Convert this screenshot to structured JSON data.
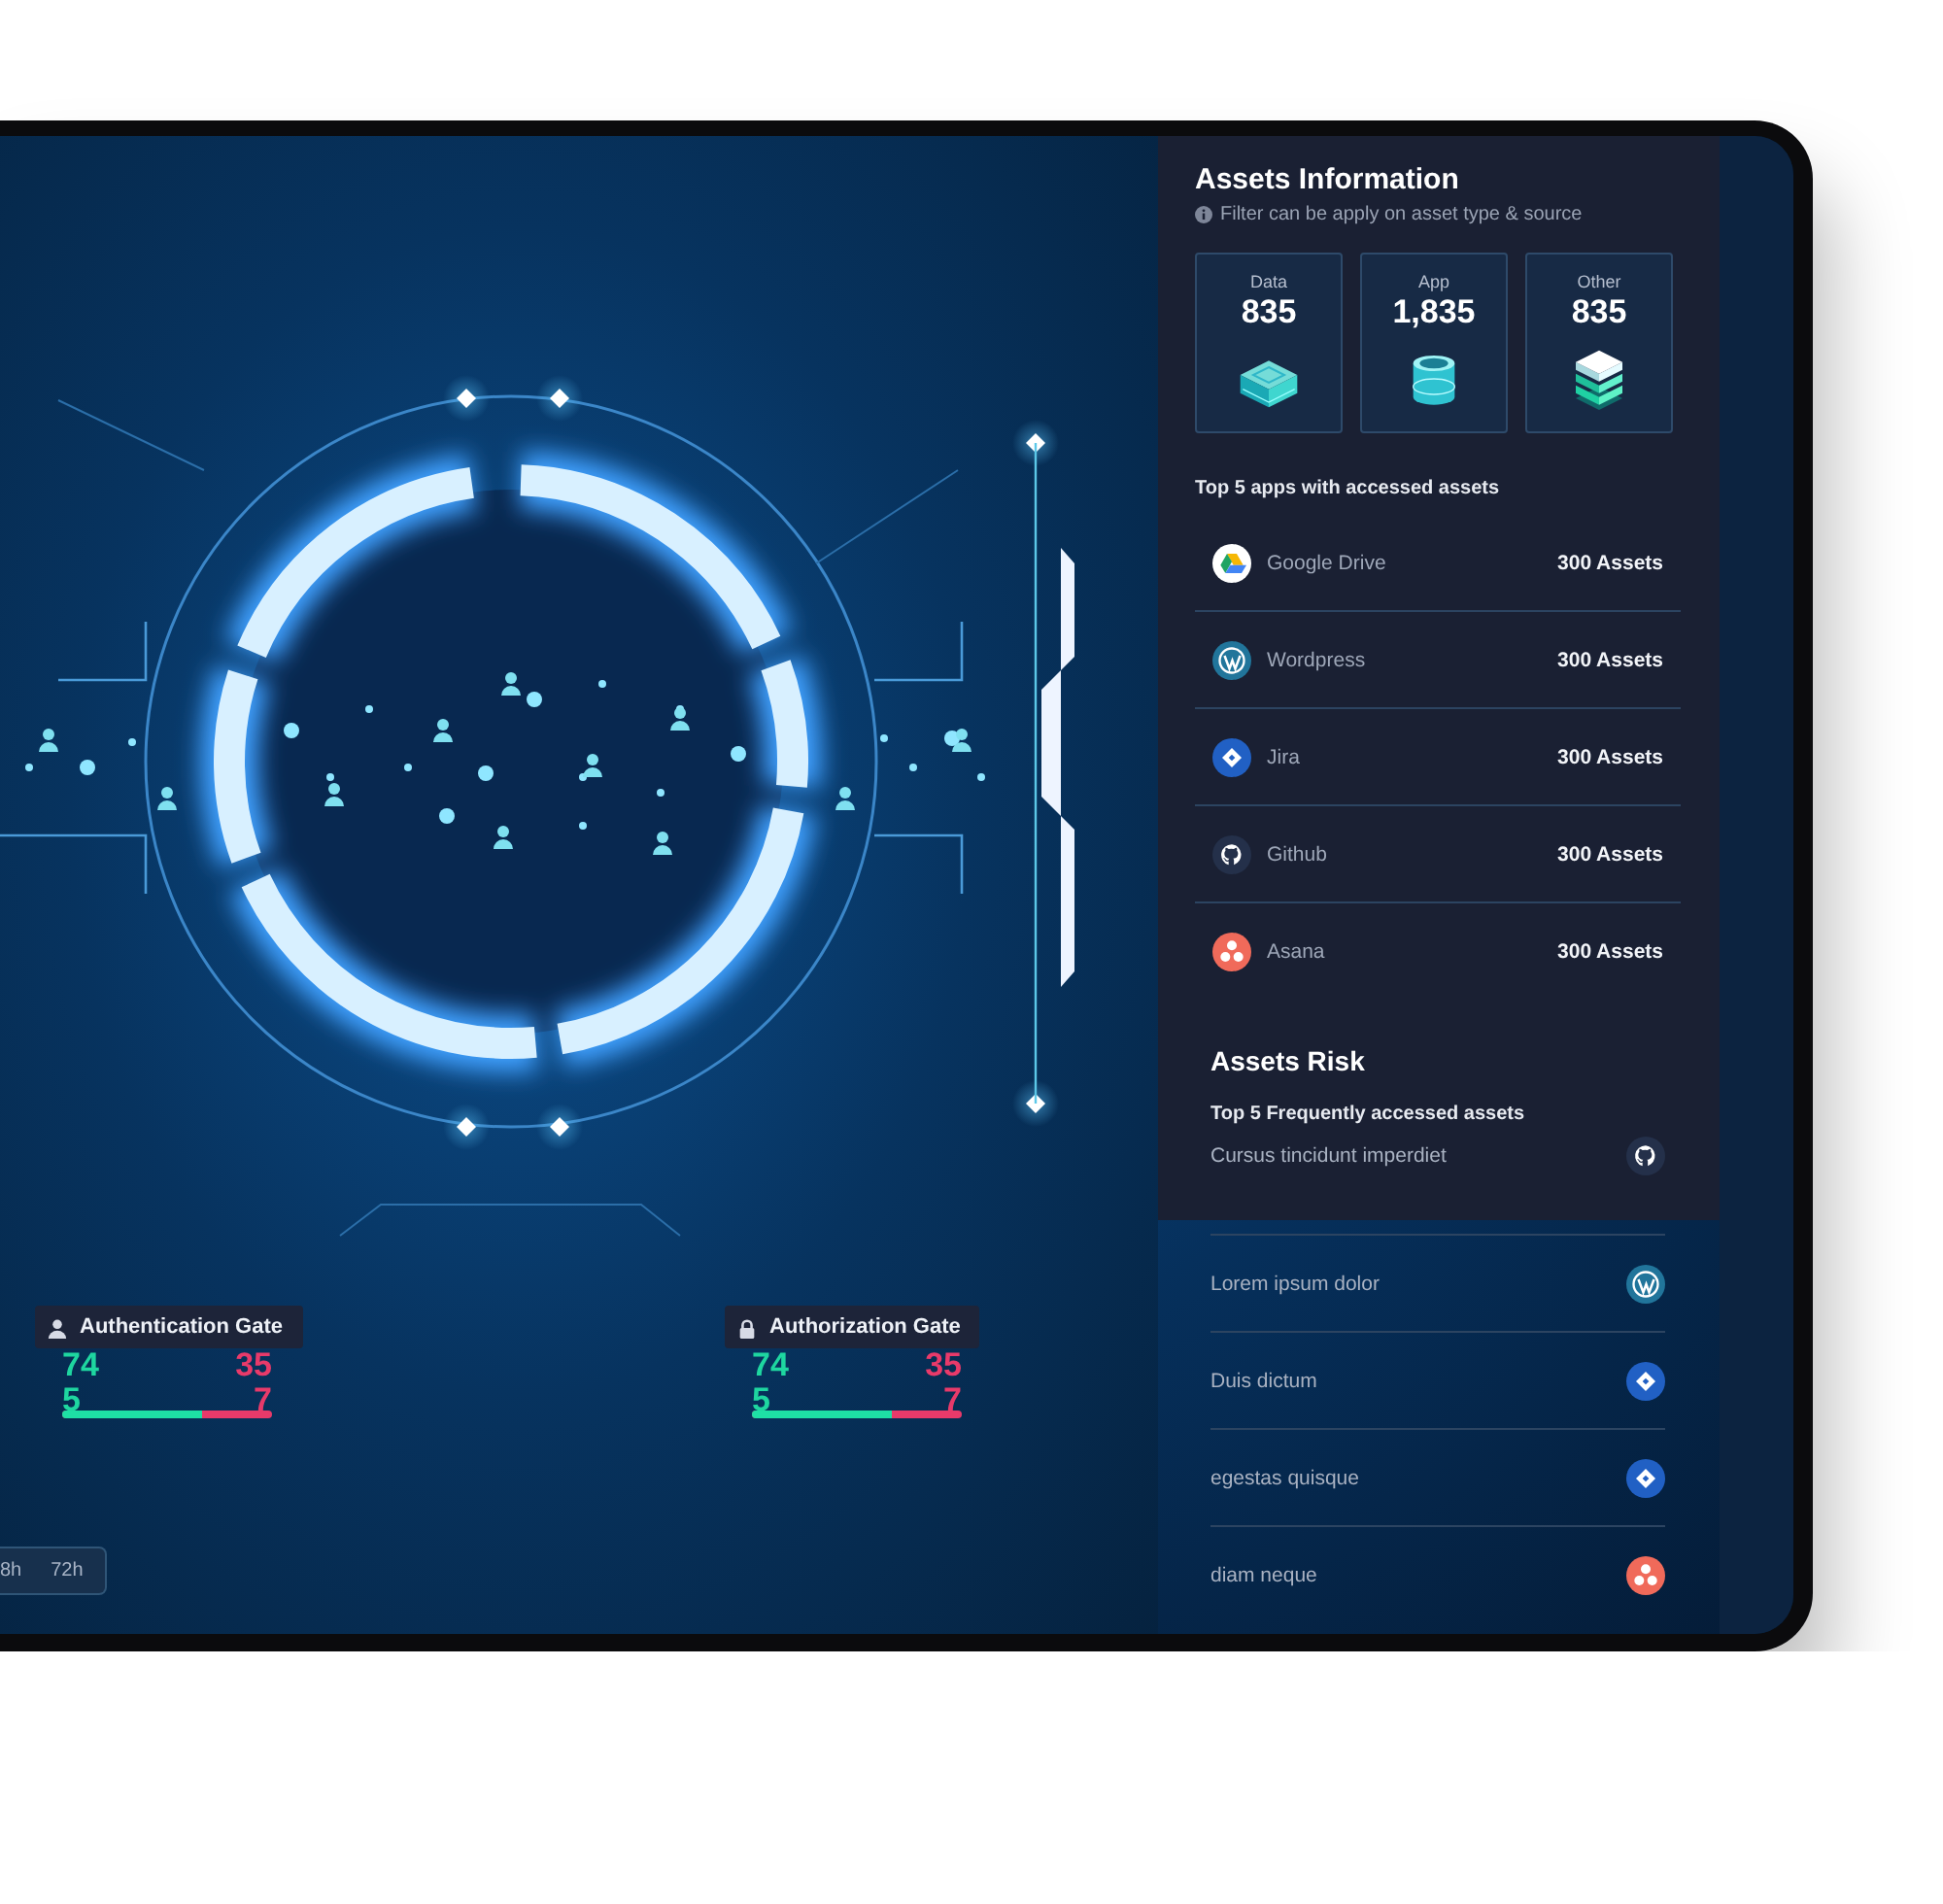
{
  "stage": {
    "gates": [
      {
        "kind": "user",
        "label": "Authentication Gate",
        "good_lines": [
          "74",
          "5"
        ],
        "bad_lines": [
          "35",
          "7"
        ],
        "level": 0.67
      },
      {
        "kind": "lock",
        "label": "Authorization Gate",
        "good_lines": [
          "74",
          "5"
        ],
        "bad_lines": [
          "35",
          "7"
        ],
        "level": 0.67
      }
    ],
    "time_ranges": [
      "8h",
      "72h"
    ]
  },
  "assets_info": {
    "title": "Assets Information",
    "hint": "Filter can be apply on asset type & source",
    "cards": [
      {
        "kind": "data",
        "label": "Data",
        "value": "835"
      },
      {
        "kind": "app",
        "label": "App",
        "value": "1,835"
      },
      {
        "kind": "other",
        "label": "Other",
        "value": "835"
      }
    ],
    "apps_title": "Top 5 apps with accessed assets",
    "apps": [
      {
        "kind": "google-drive",
        "name": "Google Drive",
        "count": "300 Assets"
      },
      {
        "kind": "wordpress",
        "name": "Wordpress",
        "count": "300 Assets"
      },
      {
        "kind": "jira",
        "name": "Jira",
        "count": "300 Assets"
      },
      {
        "kind": "github",
        "name": "Github",
        "count": "300 Assets"
      },
      {
        "kind": "asana",
        "name": "Asana",
        "count": "300 Assets"
      }
    ]
  },
  "assets_risk": {
    "title": "Assets Risk",
    "subtitle": "Top 5 Frequently accessed assets",
    "items": [
      {
        "name": "Cursus tincidunt imperdiet",
        "kind": "github"
      },
      {
        "name": "Lorem ipsum dolor",
        "kind": "wordpress"
      },
      {
        "name": "Duis dictum",
        "kind": "jira"
      },
      {
        "name": "egestas quisque",
        "kind": "jira"
      },
      {
        "name": "diam neque",
        "kind": "asana"
      }
    ]
  }
}
